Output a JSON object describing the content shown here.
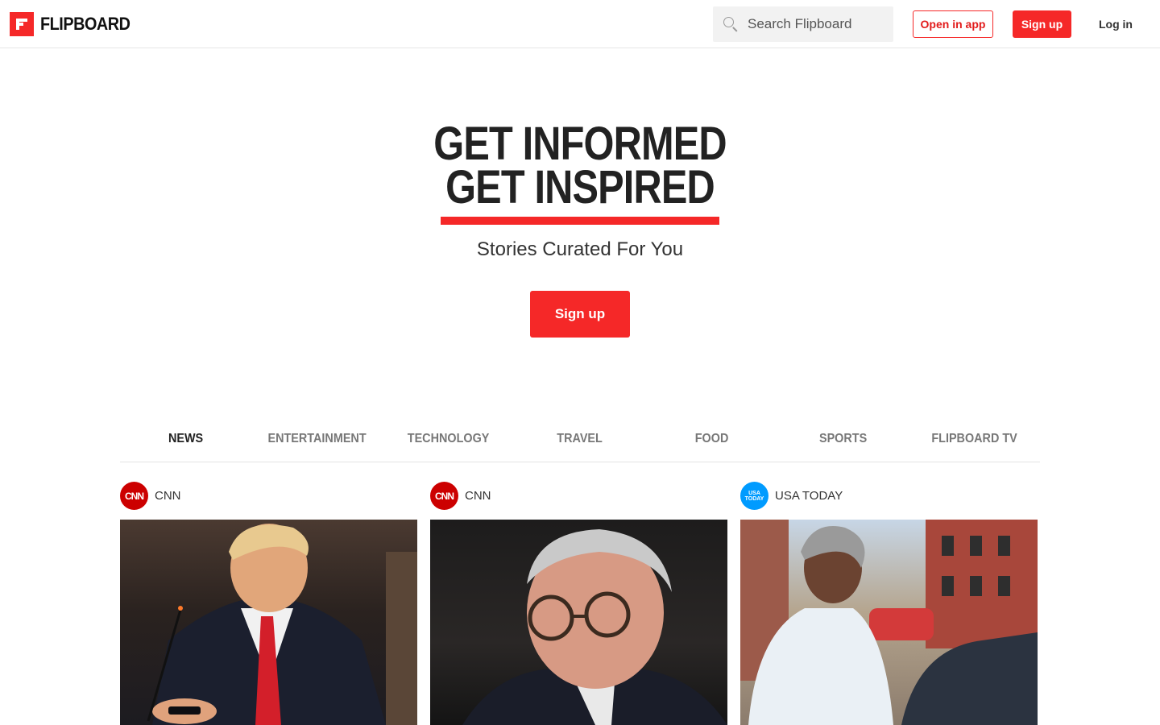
{
  "header": {
    "brand": "FLIPBOARD",
    "search_placeholder": "Search Flipboard",
    "open_in_app": "Open in app",
    "sign_up": "Sign up",
    "log_in": "Log in"
  },
  "hero": {
    "line1": "GET INFORMED",
    "line2": "GET INSPIRED",
    "subtitle": "Stories Curated For You",
    "cta": "Sign up"
  },
  "tabs": [
    {
      "label": "NEWS",
      "active": true
    },
    {
      "label": "ENTERTAINMENT",
      "active": false
    },
    {
      "label": "TECHNOLOGY",
      "active": false
    },
    {
      "label": "TRAVEL",
      "active": false
    },
    {
      "label": "FOOD",
      "active": false
    },
    {
      "label": "SPORTS",
      "active": false
    },
    {
      "label": "FLIPBOARD TV",
      "active": false
    }
  ],
  "cards": [
    {
      "source": "CNN",
      "logo_text": "CNN"
    },
    {
      "source": "CNN",
      "logo_text": "CNN"
    },
    {
      "source": "USA TODAY",
      "logo_text": "USA TODAY"
    }
  ],
  "colors": {
    "brand_red": "#f52828",
    "text_dark": "#222222",
    "tab_inactive": "#777777"
  }
}
